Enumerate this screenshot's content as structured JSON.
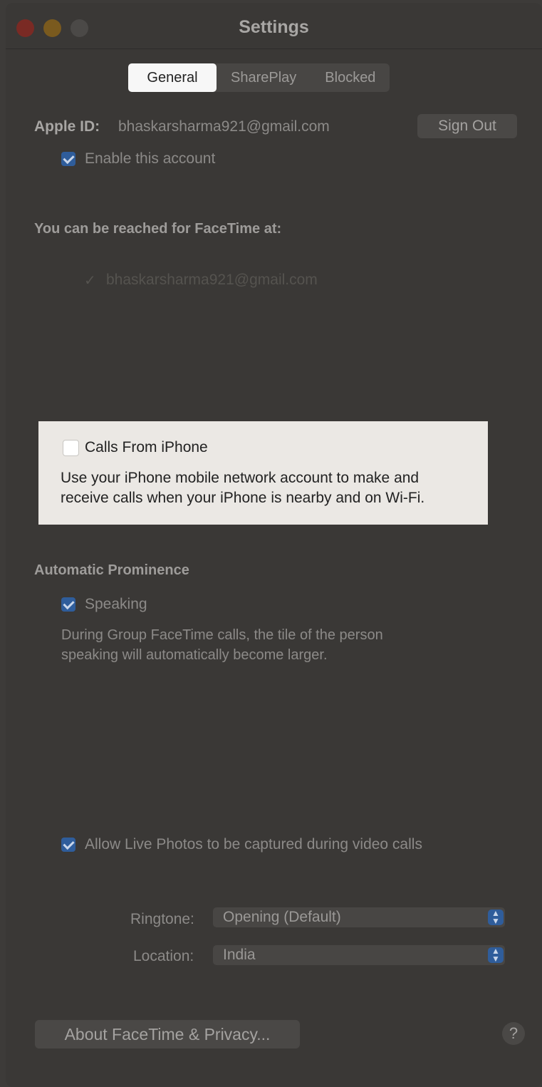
{
  "window": {
    "title": "Settings"
  },
  "tabs": [
    {
      "label": "General",
      "active": true
    },
    {
      "label": "SharePlay",
      "active": false
    },
    {
      "label": "Blocked",
      "active": false
    }
  ],
  "account": {
    "apple_id_label": "Apple ID:",
    "apple_id_value": "bhaskarsharma921@gmail.com",
    "sign_out_label": "Sign Out",
    "enable_label": "Enable this account",
    "enable_checked": true
  },
  "reach": {
    "heading": "You can be reached for FaceTime at:",
    "addresses": [
      {
        "check": "✓",
        "value": "bhaskarsharma921@gmail.com"
      }
    ]
  },
  "calls_from_iphone": {
    "label": "Calls From iPhone",
    "checked": false,
    "description_line1": "Use your iPhone mobile network account to make and",
    "description_line2": "receive calls when your iPhone is nearby and on Wi-Fi."
  },
  "prominence": {
    "heading": "Automatic Prominence",
    "speaking_label": "Speaking",
    "speaking_checked": true,
    "description_line1": "During Group FaceTime calls, the tile of the person",
    "description_line2": "speaking will automatically become larger."
  },
  "live_photos": {
    "label": "Allow Live Photos to be captured during video calls",
    "checked": true
  },
  "ringtone": {
    "label": "Ringtone:",
    "value": "Opening (Default)"
  },
  "location": {
    "label": "Location:",
    "value": "India"
  },
  "footer": {
    "about_label": "About FaceTime & Privacy...",
    "help_label": "?"
  },
  "colors": {
    "accent": "#2f5d9b",
    "window_bg": "#3a3836",
    "highlight_bg": "#ebe8e4"
  }
}
